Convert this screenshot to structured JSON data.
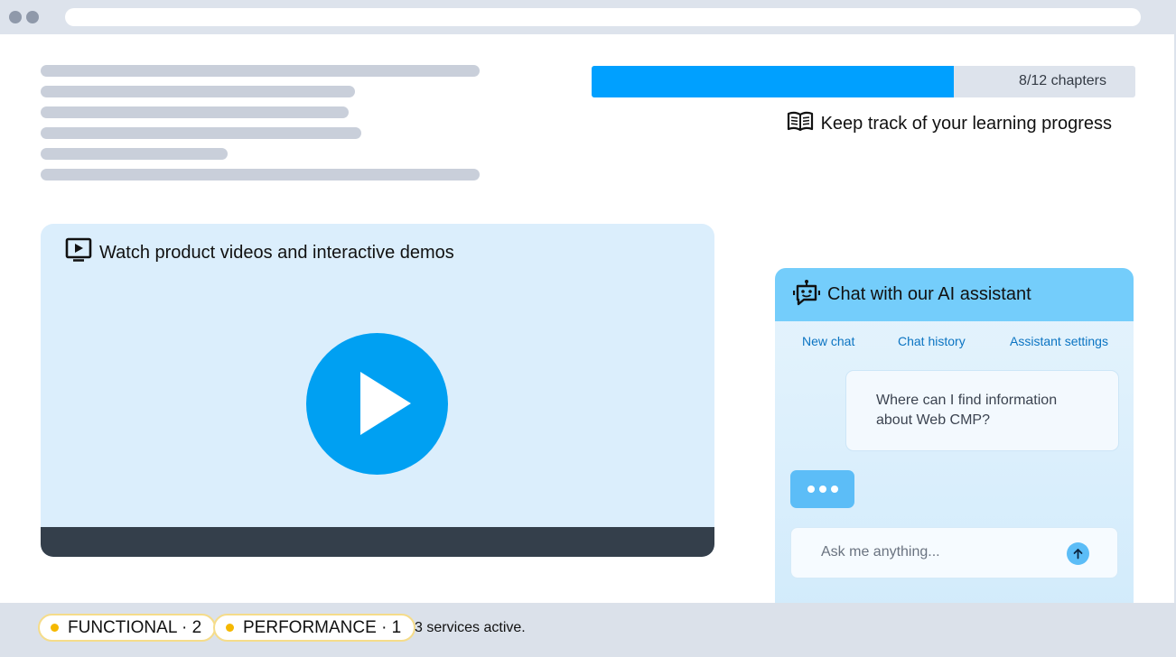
{
  "progress": {
    "fraction": 0.6667,
    "label": "8/12 chapters",
    "caption": "Keep track of your learning progress"
  },
  "video": {
    "title": "Watch product videos and interactive demos"
  },
  "chat": {
    "title": "Chat with our AI assistant",
    "nav": [
      "New chat",
      "Chat history",
      "Assistant settings"
    ],
    "user_message": "Where can I find information about Web CMP?",
    "input_placeholder": "Ask me anything..."
  },
  "footer": {
    "categories": [
      {
        "label": "FUNCTIONAL · 2"
      },
      {
        "label": "PERFORMANCE · 1"
      }
    ],
    "status": "3 services active."
  },
  "colors": {
    "accent": "#00a0ff",
    "chat_header": "#74cdfb",
    "pill_dot": "#f5b800"
  },
  "icons": [
    "book-open-icon",
    "video-play-icon",
    "robot-icon",
    "typing-indicator",
    "arrow-up-icon"
  ]
}
